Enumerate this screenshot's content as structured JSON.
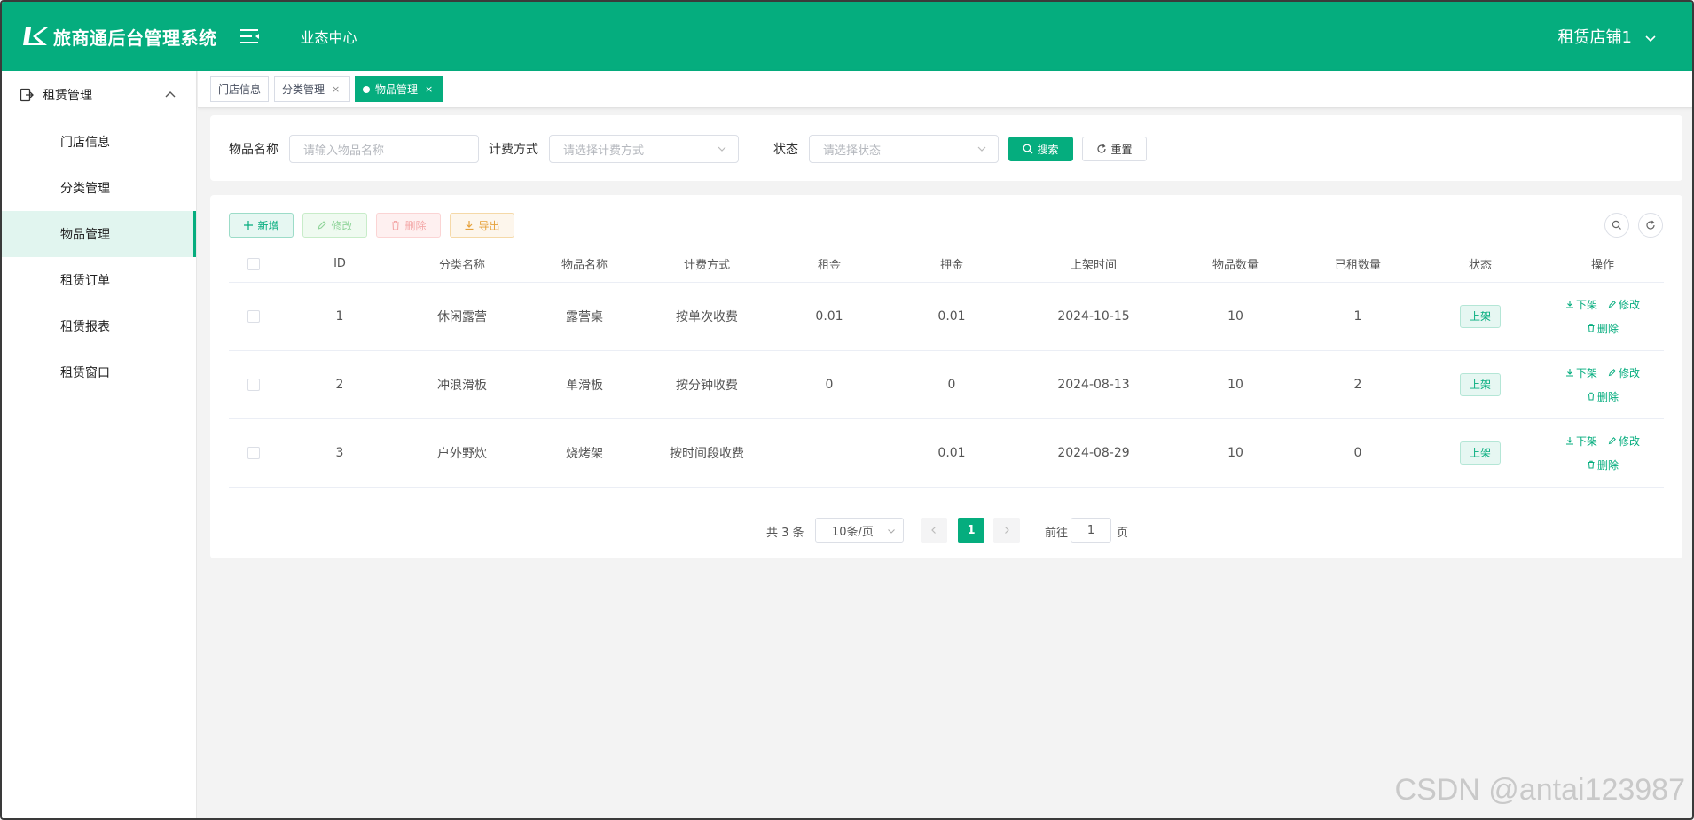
{
  "app": {
    "title": "旅商通后台管理系统",
    "nav_item": "业态中心",
    "user_label": "租赁店铺1"
  },
  "sidebar": {
    "group_label": "租赁管理",
    "items": [
      {
        "label": "门店信息",
        "active": false
      },
      {
        "label": "分类管理",
        "active": false
      },
      {
        "label": "物品管理",
        "active": true
      },
      {
        "label": "租赁订单",
        "active": false
      },
      {
        "label": "租赁报表",
        "active": false
      },
      {
        "label": "租赁窗口",
        "active": false
      }
    ]
  },
  "tabs": [
    {
      "label": "门店信息",
      "active": false,
      "closable": false
    },
    {
      "label": "分类管理",
      "active": false,
      "closable": true,
      "close": "×"
    },
    {
      "label": "物品管理",
      "active": true,
      "closable": true,
      "close": "×"
    }
  ],
  "search": {
    "name_label": "物品名称",
    "name_placeholder": "请输入物品名称",
    "billing_label": "计费方式",
    "billing_placeholder": "请选择计费方式",
    "status_label": "状态",
    "status_placeholder": "请选择状态",
    "search_button": "搜索",
    "reset_button": "重置"
  },
  "toolbar": {
    "add": "新增",
    "edit": "修改",
    "delete": "删除",
    "export": "导出"
  },
  "table": {
    "columns": [
      "ID",
      "分类名称",
      "物品名称",
      "计费方式",
      "租金",
      "押金",
      "上架时间",
      "物品数量",
      "已租数量",
      "状态",
      "操作"
    ],
    "rows": [
      {
        "id": "1",
        "category": "休闲露营",
        "name": "露营桌",
        "billing": "按单次收费",
        "rent": "0.01",
        "deposit": "0.01",
        "listed": "2024-10-15",
        "qty": "10",
        "rented": "1",
        "status": "上架"
      },
      {
        "id": "2",
        "category": "冲浪滑板",
        "name": "单滑板",
        "billing": "按分钟收费",
        "rent": "0",
        "deposit": "0",
        "listed": "2024-08-13",
        "qty": "10",
        "rented": "2",
        "status": "上架"
      },
      {
        "id": "3",
        "category": "户外野炊",
        "name": "烧烤架",
        "billing": "按时间段收费",
        "rent": "",
        "deposit": "0.01",
        "listed": "2024-08-29",
        "qty": "10",
        "rented": "0",
        "status": "上架"
      }
    ],
    "ops": {
      "offline": "下架",
      "edit": "修改",
      "delete": "删除"
    }
  },
  "pagination": {
    "total": "共 3 条",
    "page_size": "10条/页",
    "current_page": "1",
    "goto_prefix": "前往",
    "goto_value": "1",
    "goto_suffix": "页"
  },
  "watermark": "CSDN @antai123987",
  "colors": {
    "primary": "#05ad7e",
    "primary_light": "#e6f7f2",
    "danger_light": "#fef0f0",
    "warning": "#e6a23c"
  }
}
